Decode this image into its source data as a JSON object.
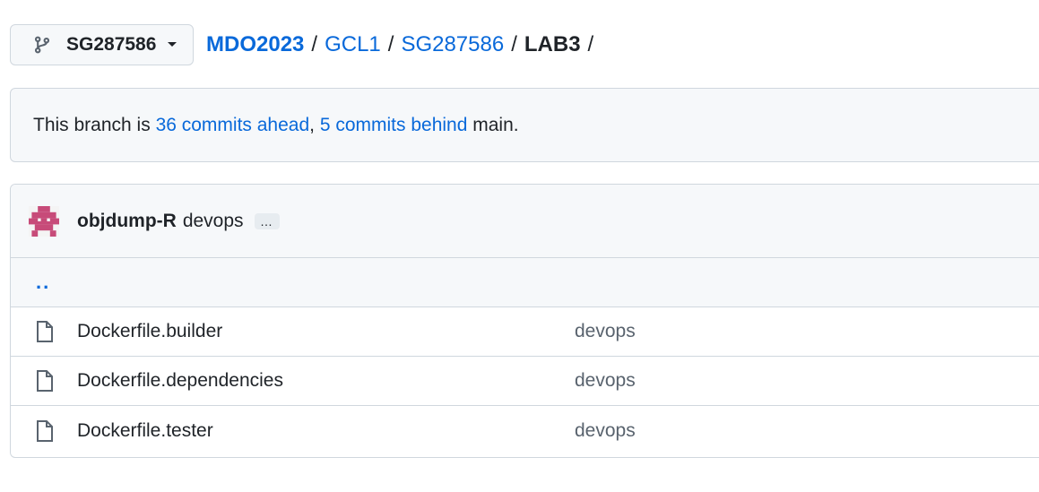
{
  "branch_selector": {
    "name": "SG287586",
    "icon": "git-branch-icon"
  },
  "breadcrumb": {
    "root": "MDO2023",
    "items": [
      "GCL1",
      "SG287586"
    ],
    "current": "LAB3",
    "separator": "/"
  },
  "branch_status": {
    "prefix": "This branch is ",
    "ahead_link": "36 commits ahead",
    "middle": ", ",
    "behind_link": "5 commits behind",
    "suffix": " main."
  },
  "latest_commit": {
    "author": "objdump-R",
    "message": "devops",
    "expand_label": "…"
  },
  "parent_dir": {
    "label": ".."
  },
  "files": [
    {
      "name": "Dockerfile.builder",
      "commit_message": "devops",
      "icon": "file-icon"
    },
    {
      "name": "Dockerfile.dependencies",
      "commit_message": "devops",
      "icon": "file-icon"
    },
    {
      "name": "Dockerfile.tester",
      "commit_message": "devops",
      "icon": "file-icon"
    }
  ],
  "colors": {
    "link": "#0969da",
    "border": "#d0d7de",
    "muted_bg": "#f6f8fa",
    "avatar": "#c74b79"
  }
}
